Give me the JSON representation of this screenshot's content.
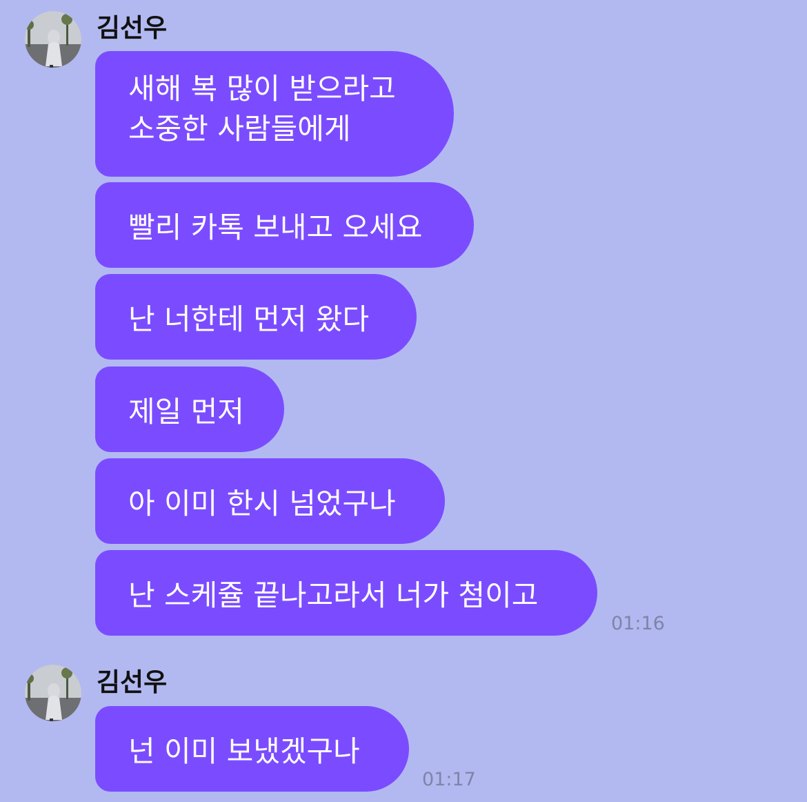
{
  "theme": {
    "background": "#b2b9f1",
    "bubble_color": "#7b4cff",
    "bubble_text_color": "#ffffff",
    "timestamp_color": "#7f84a6"
  },
  "messages": [
    {
      "sender": "김선우",
      "avatar_icon": "profile-photo",
      "lines": [
        "새해 복 많이 받으라고",
        "소중한 사람들에게"
      ],
      "bubbles": [
        "빨리 카톡 보내고 오세요",
        "난 너한테 먼저 왔다",
        "제일 먼저",
        "아 이미 한시 넘었구나",
        "난 스케쥴 끝나고라서 너가 첨이고"
      ],
      "time": "01:16"
    },
    {
      "sender": "김선우",
      "avatar_icon": "profile-photo",
      "bubbles": [
        "넌 이미 보냈겠구나"
      ],
      "time": "01:17"
    }
  ]
}
